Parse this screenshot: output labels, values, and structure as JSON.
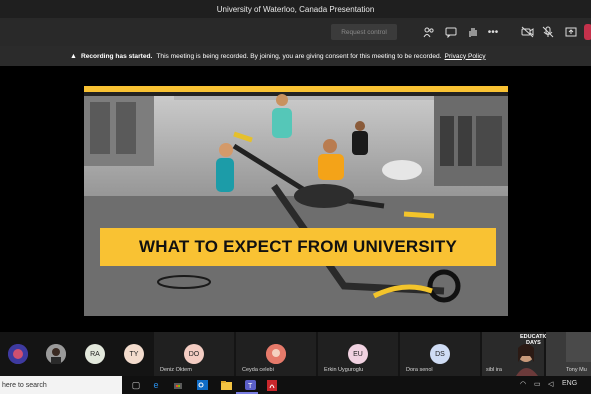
{
  "window": {
    "title": "University of Waterloo, Canada Presentation"
  },
  "toolbar": {
    "request_control_label": "Request control",
    "icons": [
      "people-icon",
      "chat-icon",
      "raise-hand-icon",
      "more-icon",
      "camera-off-icon",
      "mic-off-icon",
      "share-icon",
      "leave-icon"
    ]
  },
  "banner": {
    "icon": "warning-icon",
    "heading": "Recording has started.",
    "message": "This meeting is being recorded. By joining, you are giving consent for this meeting to be recorded.",
    "link": "Privacy Policy"
  },
  "slide": {
    "headline": "WHAT TO EXPECT FROM UNIVERSITY",
    "colors": {
      "accent": "#f9c233",
      "text": "#111111"
    }
  },
  "participants": [
    {
      "initials": "",
      "name": "",
      "kind": "photo"
    },
    {
      "initials": "",
      "name": "",
      "kind": "photo"
    },
    {
      "initials": "RA",
      "name": "",
      "color": "#e3e8dc"
    },
    {
      "initials": "TY",
      "name": "",
      "color": "#f3dccd"
    },
    {
      "initials": "DO",
      "name": "Deniz Oktem",
      "color": "#f4cdc3"
    },
    {
      "initials": "",
      "name": "Ceyda celebi",
      "kind": "photo"
    },
    {
      "initials": "EU",
      "name": "Erkin Uyguroglu",
      "color": "#f1d2e1"
    },
    {
      "initials": "DS",
      "name": "Dora senol",
      "color": "#cfdcf4"
    },
    {
      "initials": "",
      "name": "sibl ira",
      "kind": "video"
    },
    {
      "initials": "",
      "name": "Tony Mu",
      "kind": "video"
    }
  ],
  "video_overlay": {
    "label_1": "EDUCATION",
    "label_2": "DAYS"
  },
  "taskbar": {
    "search_placeholder": "here to search",
    "apps": [
      "task-view-icon",
      "edge-icon",
      "store-icon",
      "outlook-icon",
      "explorer-icon",
      "teams-icon",
      "pdf-icon"
    ]
  }
}
